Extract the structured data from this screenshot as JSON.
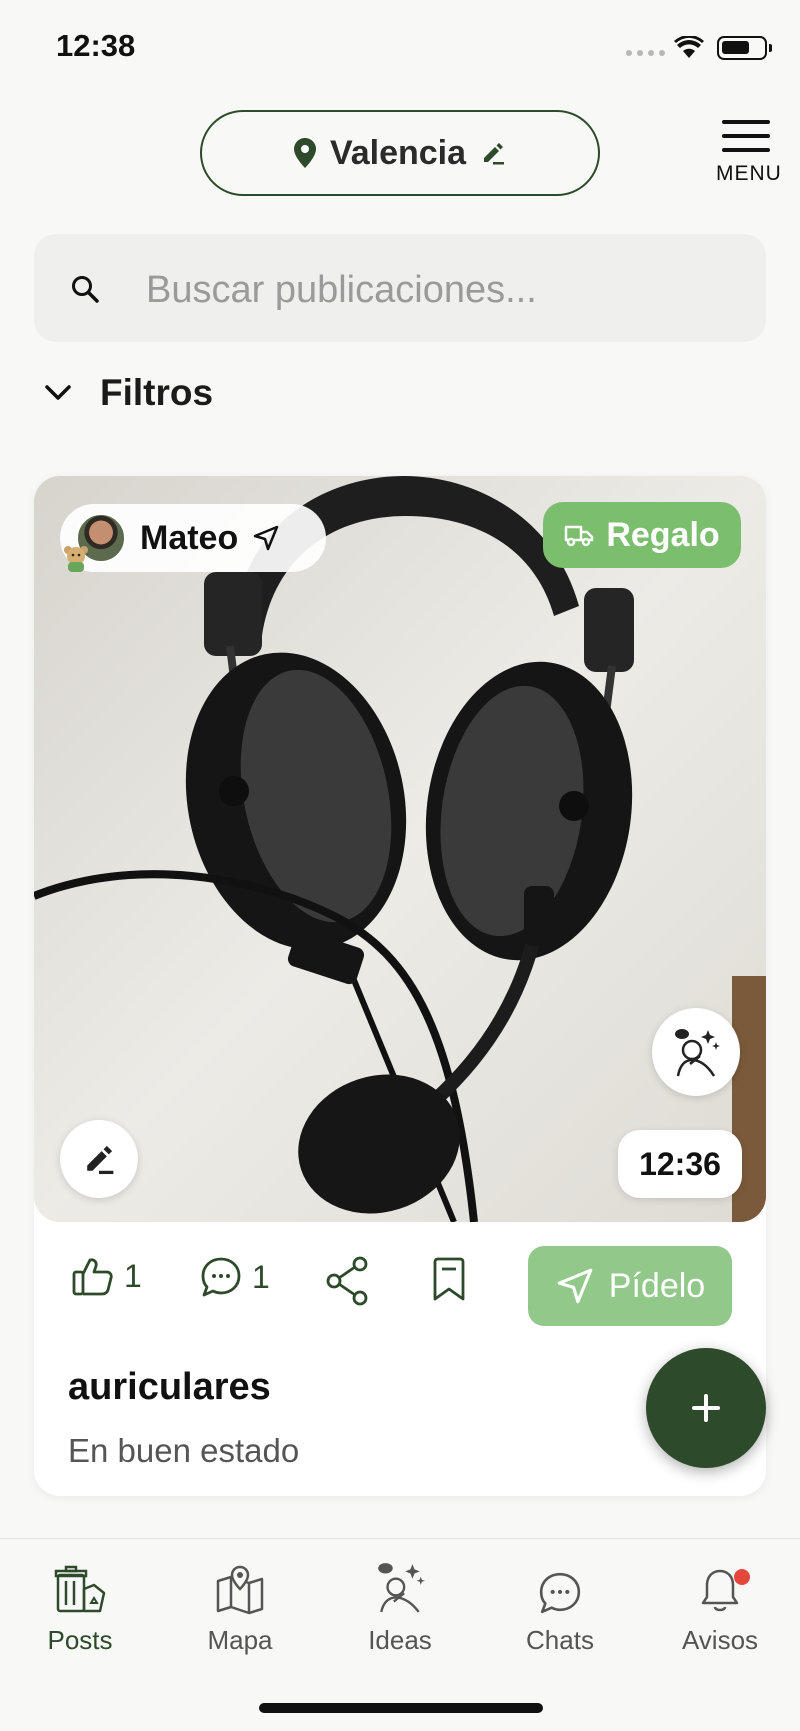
{
  "status_bar": {
    "time": "12:38"
  },
  "header": {
    "location": "Valencia",
    "menu_label": "MENU"
  },
  "search": {
    "placeholder": "Buscar publicaciones..."
  },
  "filters": {
    "label": "Filtros"
  },
  "post": {
    "user_name": "Mateo",
    "badge": "Regalo",
    "time": "12:36",
    "likes": "1",
    "comments": "1",
    "request_label": "Pídelo",
    "title": "auriculares",
    "description": "En buen estado"
  },
  "tabbar": {
    "items": [
      {
        "label": "Posts",
        "icon": "recycle-bin-icon",
        "active": true
      },
      {
        "label": "Mapa",
        "icon": "map-icon",
        "active": false
      },
      {
        "label": "Ideas",
        "icon": "ideas-icon",
        "active": false
      },
      {
        "label": "Chats",
        "icon": "chat-bubble-icon",
        "active": false
      },
      {
        "label": "Avisos",
        "icon": "bell-icon",
        "active": false,
        "has_notification": true
      }
    ]
  },
  "colors": {
    "brand_dark": "#2d4a2a",
    "brand_light": "#7bbf6e",
    "request_button": "#92c98a",
    "notification": "#e5483b"
  }
}
